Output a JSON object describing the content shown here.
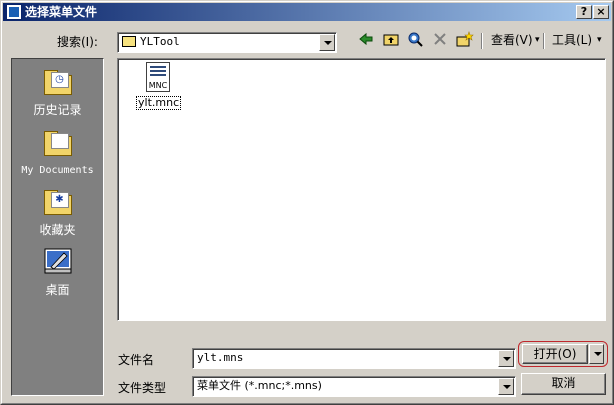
{
  "window": {
    "title": "选择菜单文件",
    "help_button": "?",
    "close_button": "×"
  },
  "toolbar": {
    "search_in_label": "搜索(I):",
    "location_value": "YLTool",
    "view_label": "查看(V)",
    "tools_label": "工具(L)"
  },
  "places": [
    {
      "label": "历史记录",
      "icon": "history-folder-icon"
    },
    {
      "label": "My Documents",
      "icon": "my-documents-folder-icon"
    },
    {
      "label": "收藏夹",
      "icon": "favorites-folder-icon"
    },
    {
      "label": "桌面",
      "icon": "desktop-icon"
    }
  ],
  "files": [
    {
      "name": "ylt.mnc",
      "icon_text": "MNC"
    }
  ],
  "form": {
    "filename_label": "文件名",
    "filename_value": "ylt.mns",
    "filetype_label": "文件类型",
    "filetype_value": "菜单文件 (*.mnc;*.mns)"
  },
  "buttons": {
    "open": "打开(O)",
    "cancel": "取消"
  },
  "colors": {
    "title_gradient_start": "#0a246a",
    "title_gradient_end": "#a6caf0",
    "face": "#d4d0c8",
    "places_bg": "#808080",
    "open_highlight": "#c0282d"
  }
}
